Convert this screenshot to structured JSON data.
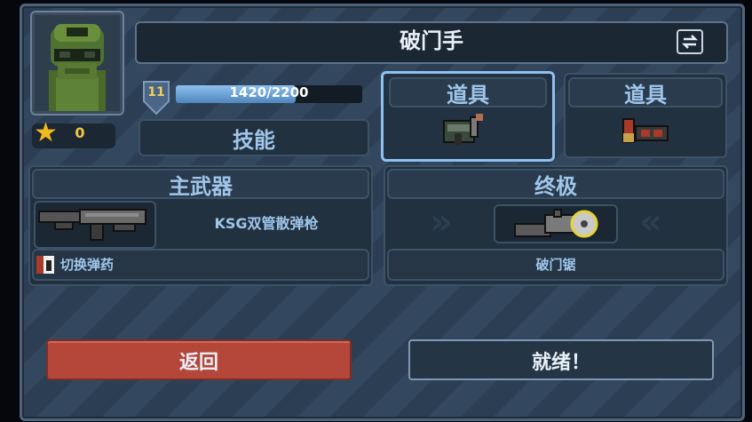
{
  "character": {
    "name": "破门手",
    "stars": "0",
    "level": "11",
    "xp_text": "1420/2200",
    "xp_progress": 0.645,
    "skill_label": "技能"
  },
  "items": [
    {
      "label": "道具",
      "icon": "hammer-icon"
    },
    {
      "label": "道具",
      "icon": "shell-ammo-icon"
    }
  ],
  "primary": {
    "header": "主武器",
    "weapon_name": "KSG双管散弹枪",
    "ability": "切换弹药",
    "icon": "shotgun-icon"
  },
  "ultimate": {
    "header": "终极",
    "name": "破门锯",
    "icon": "saw-icon"
  },
  "buttons": {
    "back": "返回",
    "ready": "就绪！"
  },
  "colors": {
    "back_button": "#b4473a",
    "ready_button": "#243546",
    "xp_fill": "#6aa7dd",
    "accent": "#9fc6ea"
  }
}
